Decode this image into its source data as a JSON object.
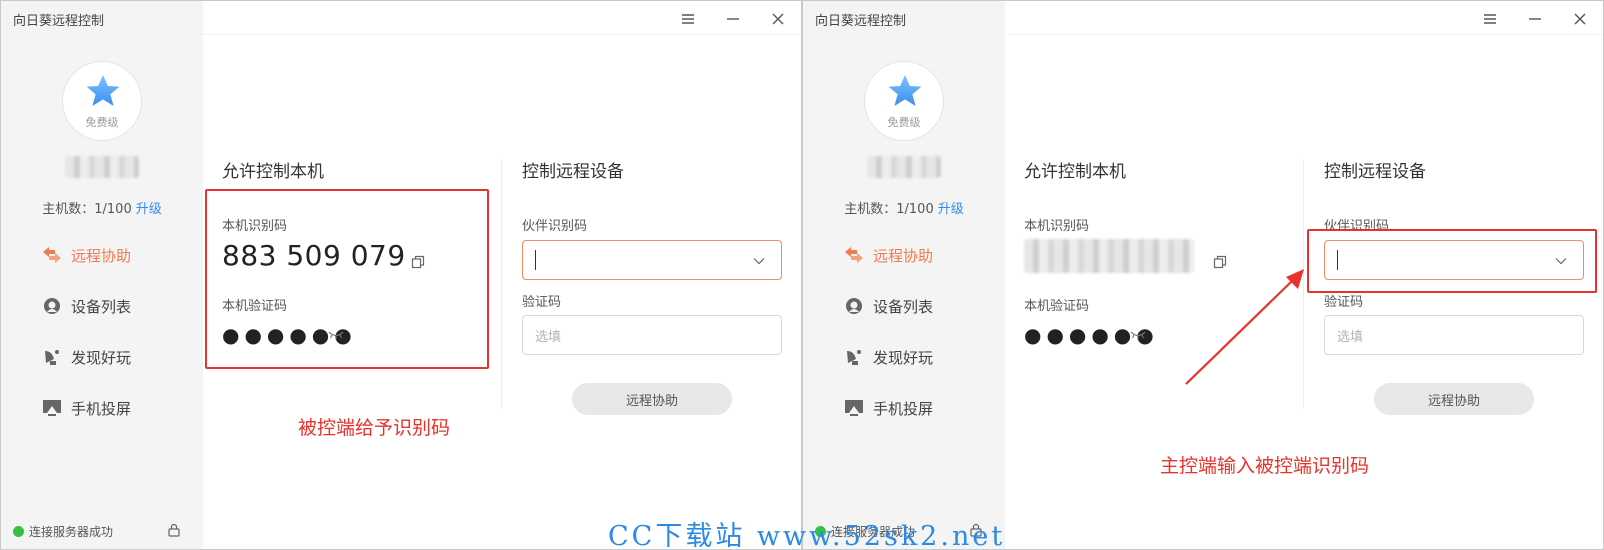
{
  "app": {
    "title": "向日葵远程控制"
  },
  "sidebar": {
    "tier": "免费级",
    "host_count_label": "主机数：1/100",
    "upgrade": "升级",
    "items": [
      {
        "label": "远程协助",
        "icon": "remote-assist-icon",
        "active": true
      },
      {
        "label": "设备列表",
        "icon": "device-list-icon",
        "active": false
      },
      {
        "label": "发现好玩",
        "icon": "discover-icon",
        "active": false
      },
      {
        "label": "手机投屏",
        "icon": "phone-cast-icon",
        "active": false
      }
    ],
    "status": "连接服务器成功"
  },
  "allow": {
    "title": "允许控制本机",
    "id_label": "本机识别码",
    "id_value": "883 509 079",
    "code_label": "本机验证码",
    "code_value": "●●●●●●"
  },
  "control": {
    "title": "控制远程设备",
    "partner_label": "伙伴识别码",
    "verify_label": "验证码",
    "verify_placeholder": "选填",
    "assist_button": "远程协助"
  },
  "annotations": {
    "left": "被控端给予识别码",
    "right": "主控端输入被控端识别码"
  },
  "watermark": "CC下载站 www.52sk2.net",
  "colors": {
    "accent": "#f07a4f",
    "link": "#2f8ff0",
    "annotation": "#e8332b",
    "status_ok": "#34c043",
    "watermark": "#2b8ae6"
  }
}
